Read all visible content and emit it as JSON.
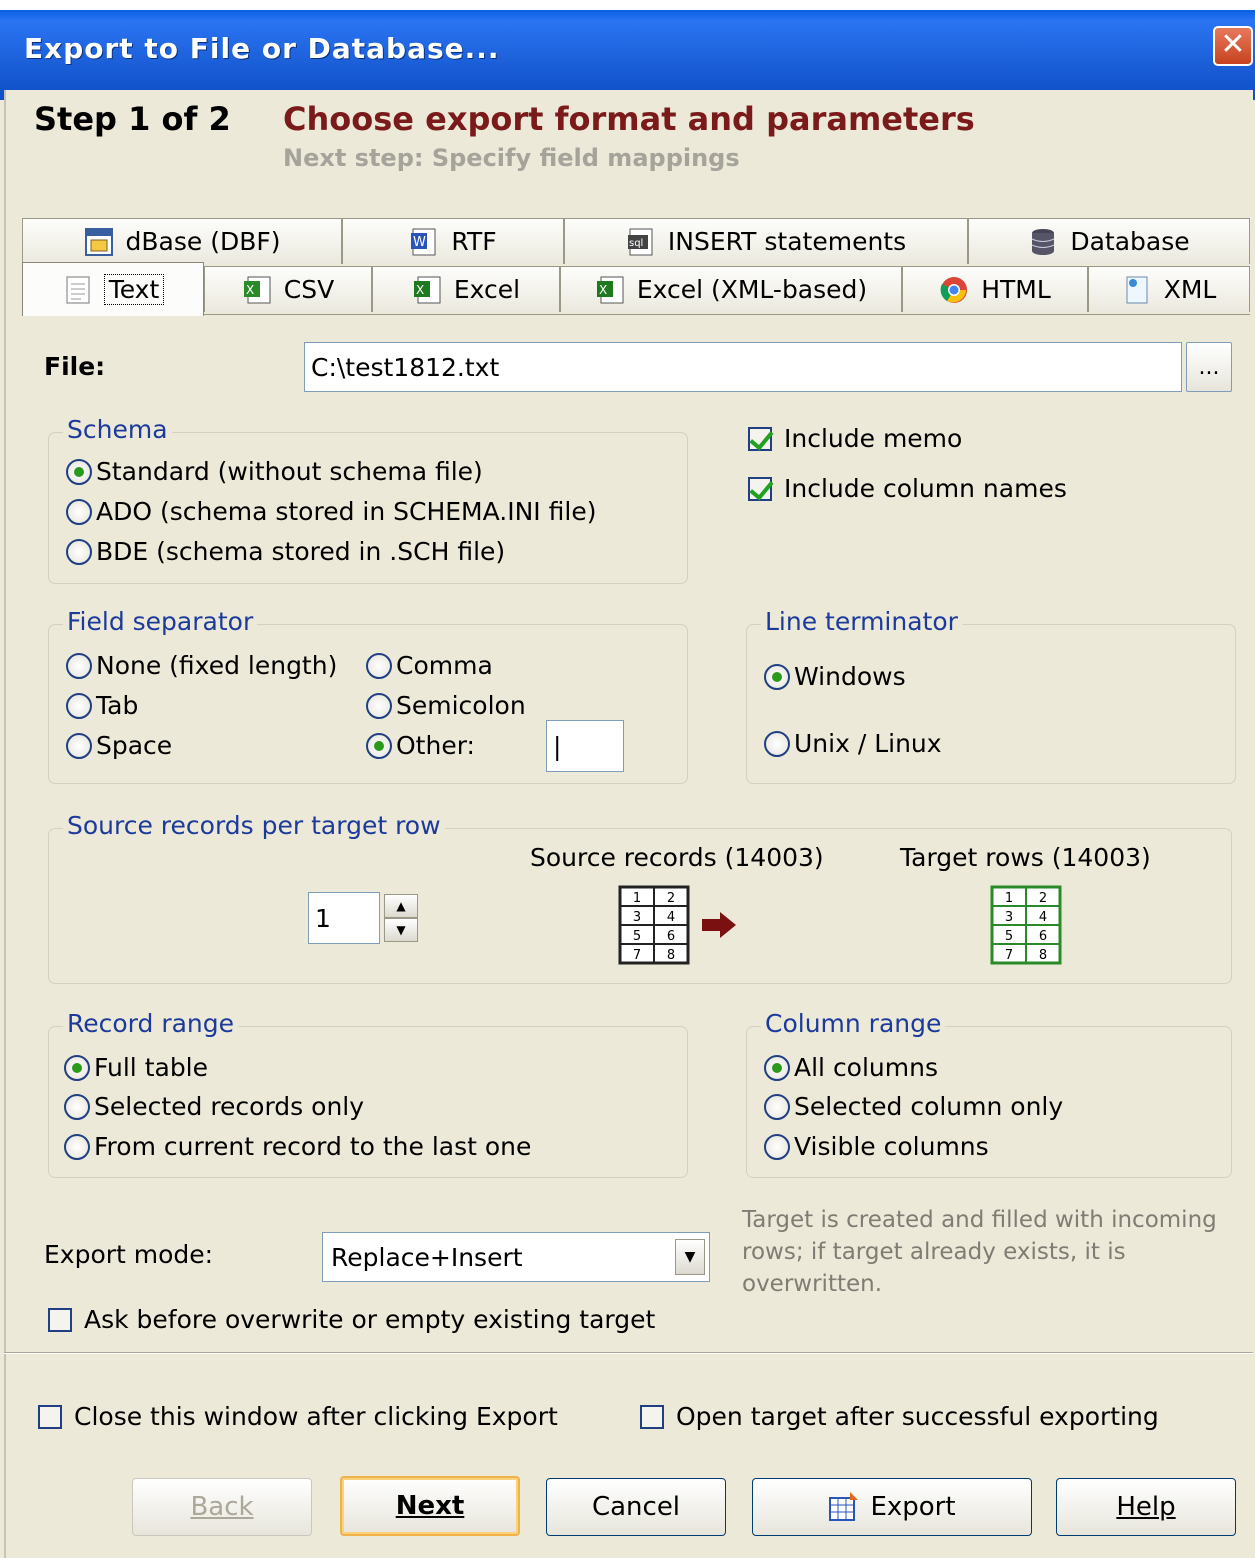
{
  "window": {
    "title": "Export to File or Database...",
    "close_glyph": "✕"
  },
  "header": {
    "step": "Step 1 of 2",
    "title": "Choose export format and parameters",
    "next_step": "Next step: Specify field mappings"
  },
  "tabs_row1": [
    "dBase (DBF)",
    "RTF",
    "INSERT statements",
    "Database"
  ],
  "tabs_row2": [
    "Text",
    "CSV",
    "Excel",
    "Excel (XML-based)",
    "HTML",
    "XML"
  ],
  "active_tab": "Text",
  "file": {
    "label": "File:",
    "value": "C:\\test1812.txt",
    "browse": "..."
  },
  "schema": {
    "label": "Schema",
    "options": [
      "Standard (without schema file)",
      "ADO (schema stored in SCHEMA.INI file)",
      "BDE (schema stored in .SCH file)"
    ],
    "selected": 0
  },
  "checks": {
    "include_memo": "Include memo",
    "include_column_names": "Include column names"
  },
  "field_separator": {
    "label": "Field separator",
    "options": [
      "None (fixed length)",
      "Comma",
      "Tab",
      "Semicolon",
      "Space",
      "Other:"
    ],
    "selected": "Other:",
    "other_value": "|"
  },
  "line_terminator": {
    "label": "Line terminator",
    "options": [
      "Windows",
      "Unix / Linux"
    ],
    "selected": 0
  },
  "records_per_row": {
    "label": "Source records per target row",
    "value": "1",
    "source_label": "Source records (14003)",
    "target_label": "Target rows (14003)",
    "grid_cells": [
      "1",
      "2",
      "3",
      "4",
      "5",
      "6",
      "7",
      "8"
    ]
  },
  "record_range": {
    "label": "Record range",
    "options": [
      "Full table",
      "Selected records only",
      "From current record to the last one"
    ],
    "selected": 0
  },
  "column_range": {
    "label": "Column range",
    "options": [
      "All columns",
      "Selected column only",
      "Visible columns"
    ],
    "selected": 0
  },
  "export_mode": {
    "label": "Export mode:",
    "value": "Replace+Insert",
    "note": "Target is created and filled with incoming rows; if target already exists, it is overwritten."
  },
  "ask_before_overwrite": "Ask before overwrite or empty existing target",
  "footer": {
    "close_after": "Close this window after clicking Export",
    "open_target": "Open target after successful exporting"
  },
  "buttons": {
    "back": "Back",
    "next": "Next",
    "cancel": "Cancel",
    "export": "Export",
    "help": "Help"
  },
  "colors": {
    "titlebar": "#1b5fd8",
    "heading": "#7a1a1a",
    "group_label": "#1c3a9c",
    "arrow": "#7a1010",
    "target_grid": "#2a8a2a"
  }
}
